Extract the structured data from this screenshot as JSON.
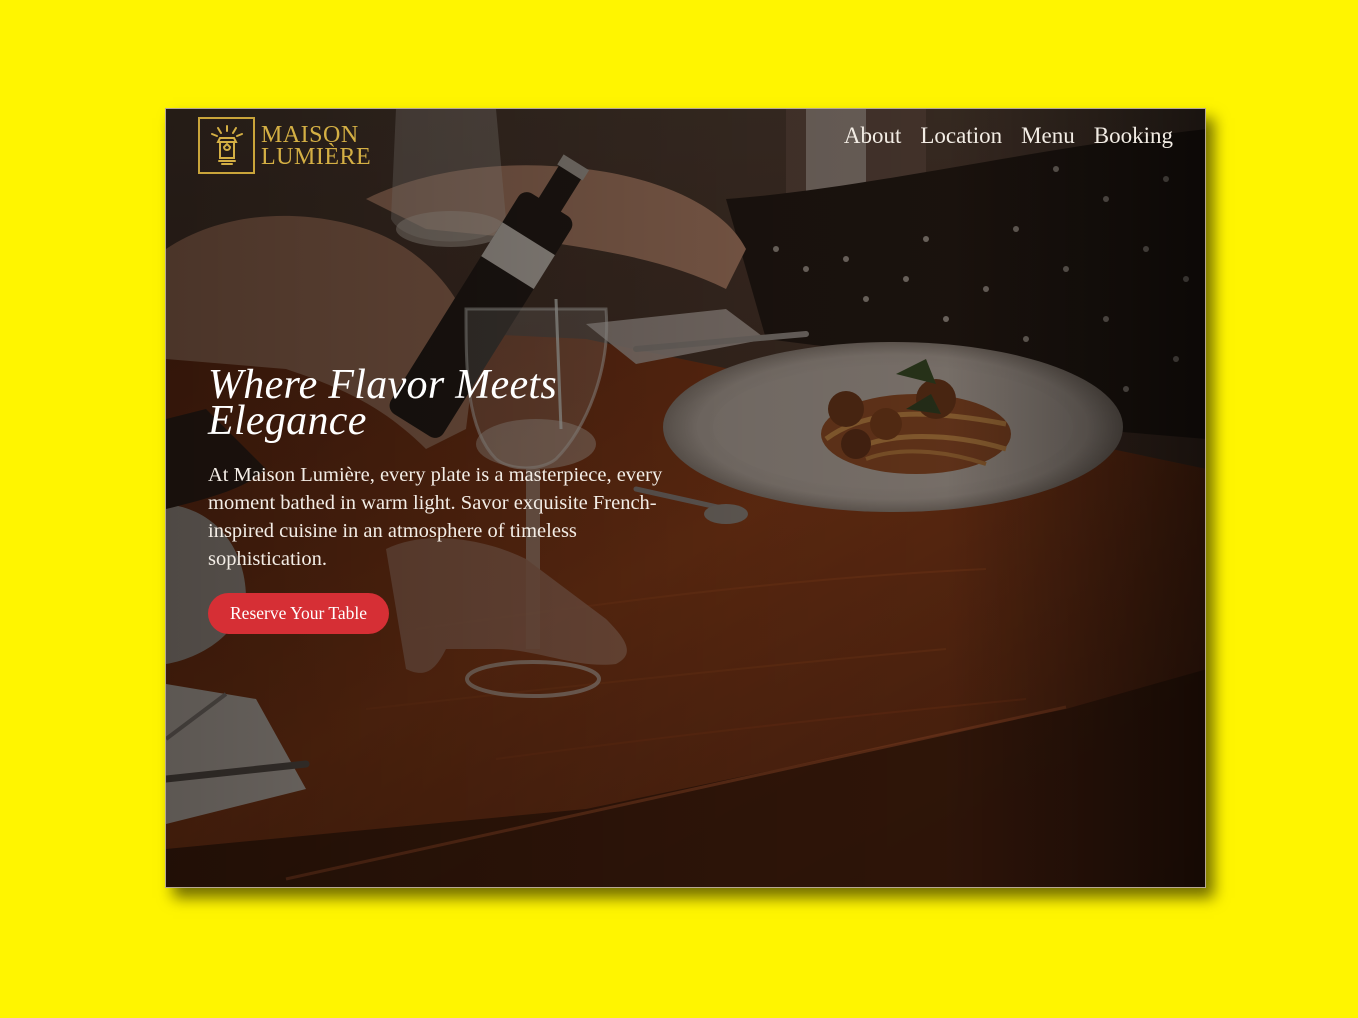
{
  "brand": {
    "line1": "MAISON",
    "line2": "LUMIÈRE",
    "icon": "lantern-icon",
    "color": "#d4af44"
  },
  "nav": {
    "items": [
      {
        "label": "About"
      },
      {
        "label": "Location"
      },
      {
        "label": "Menu"
      },
      {
        "label": "Booking"
      }
    ]
  },
  "hero": {
    "headline": "Where Flavor Meets Elegance",
    "description": "At Maison Lumière, every plate is a masterpiece, every moment bathed in warm light. Savor exquisite French-inspired cuisine in an atmosphere of timeless sophistication.",
    "cta_label": "Reserve Your Table",
    "cta_color": "#d62f35"
  },
  "colors": {
    "page_background": "#fff500",
    "overlay": "#1c120c"
  }
}
